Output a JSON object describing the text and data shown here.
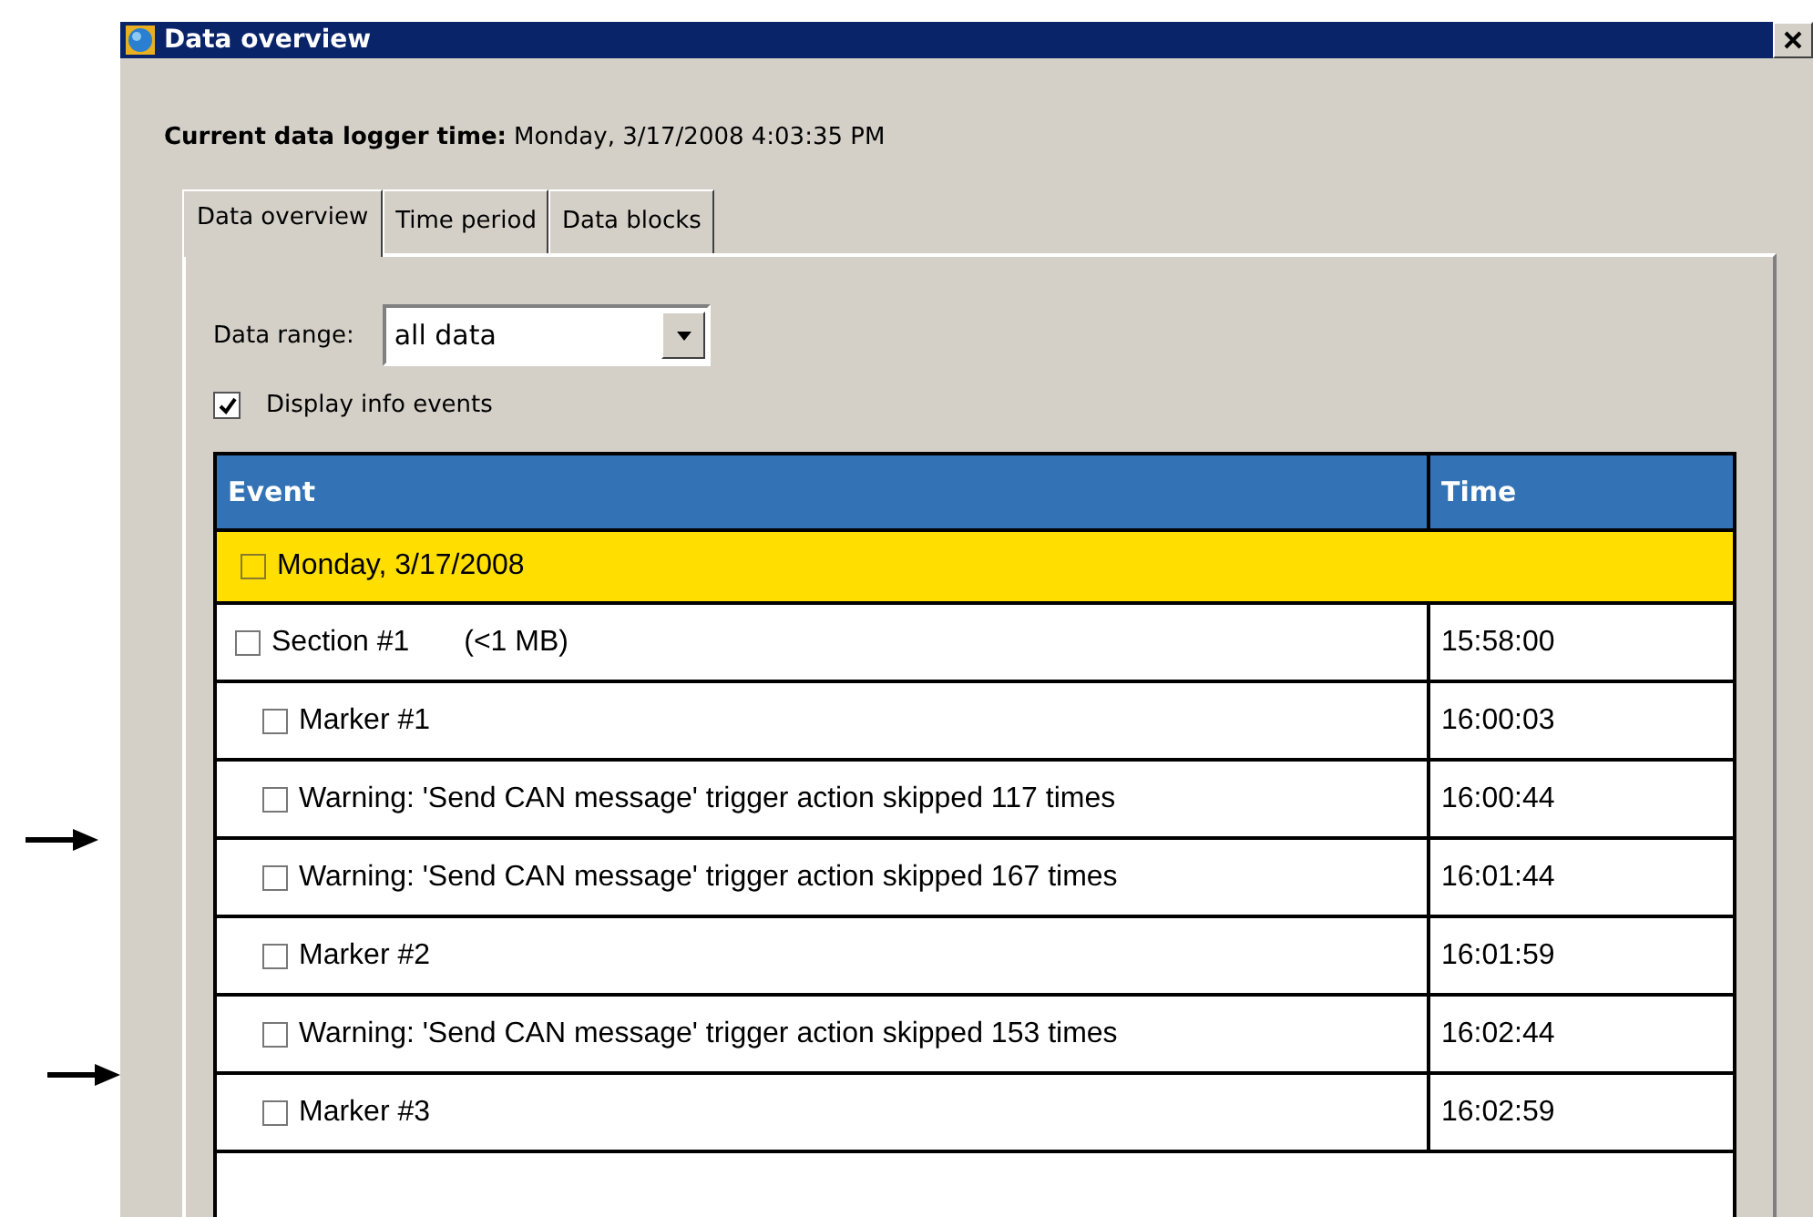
{
  "window": {
    "title": "Data overview"
  },
  "logger_time": {
    "label": "Current data logger time:",
    "value": "Monday, 3/17/2008 4:03:35 PM"
  },
  "tabs": [
    {
      "label": "Data overview",
      "selected": true
    },
    {
      "label": "Time period",
      "selected": false
    },
    {
      "label": "Data blocks",
      "selected": false
    }
  ],
  "data_range": {
    "label": "Data range:",
    "value": "all data"
  },
  "display_info_events": {
    "label": "Display info events",
    "checked": true
  },
  "table": {
    "columns": [
      "Event",
      "Time"
    ],
    "rows": [
      {
        "event": "Monday, 3/17/2008",
        "kind": "date",
        "checked": false,
        "children": [
          {
            "event": "Section #1",
            "size": "(<1 MB)",
            "time": "15:58:00",
            "kind": "section",
            "checked": false,
            "children": [
              {
                "event": "Marker #1",
                "time": "16:00:03",
                "kind": "item",
                "checked": false,
                "pointed": false
              },
              {
                "event": "Warning: 'Send CAN message' trigger action skipped 117 times",
                "time": "16:00:44",
                "kind": "item",
                "checked": false,
                "pointed": true
              },
              {
                "event": "Warning: 'Send CAN message' trigger action skipped 167 times",
                "time": "16:01:44",
                "kind": "item",
                "checked": false,
                "pointed": false
              },
              {
                "event": "Marker #2",
                "time": "16:01:59",
                "kind": "item",
                "checked": false,
                "pointed": false
              },
              {
                "event": "Warning: 'Send CAN message' trigger action skipped 153 times",
                "time": "16:02:44",
                "kind": "item",
                "checked": false,
                "pointed": true
              },
              {
                "event": "Marker #3",
                "time": "16:02:59",
                "kind": "item",
                "checked": false,
                "pointed": false
              }
            ]
          }
        ]
      }
    ]
  }
}
